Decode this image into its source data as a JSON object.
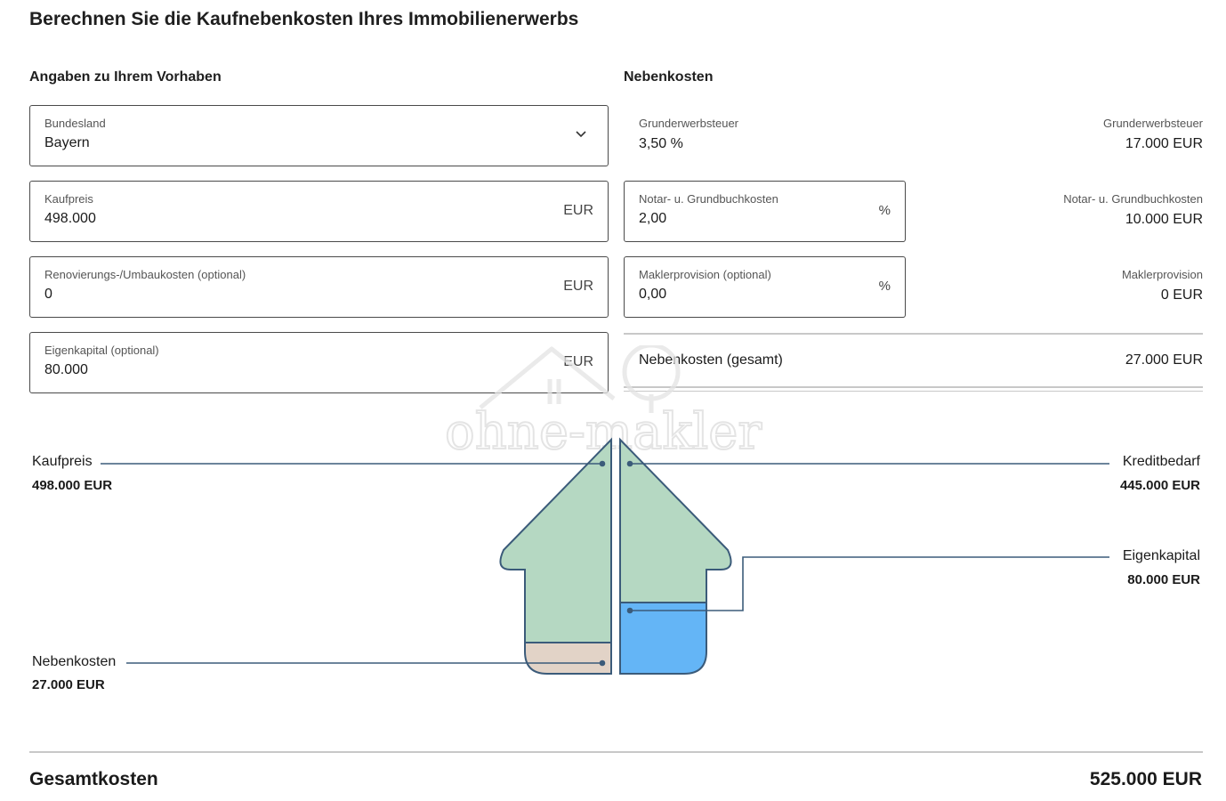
{
  "page": {
    "title": "Berechnen Sie die Kaufnebenkosten Ihres Immobilienerwerbs"
  },
  "left": {
    "section_title": "Angaben zu Ihrem Vorhaben",
    "bundesland": {
      "label": "Bundesland",
      "value": "Bayern"
    },
    "kaufpreis": {
      "label": "Kaufpreis",
      "value": "498.000",
      "unit": "EUR"
    },
    "renovierung": {
      "label": "Renovierungs-/Umbaukosten (optional)",
      "value": "0",
      "unit": "EUR"
    },
    "eigenkapital": {
      "label": "Eigenkapital (optional)",
      "value": "80.000",
      "unit": "EUR"
    }
  },
  "right": {
    "section_title": "Nebenkosten",
    "grunderwerbsteuer": {
      "label": "Grunderwerbsteuer",
      "value": "3,50 %",
      "result_label": "Grunderwerbsteuer",
      "result_value": "17.000 EUR"
    },
    "notar": {
      "label": "Notar- u. Grundbuchkosten",
      "value": "2,00",
      "unit": "%",
      "result_label": "Notar- u. Grundbuchkosten",
      "result_value": "10.000 EUR"
    },
    "makler": {
      "label": "Maklerprovision (optional)",
      "value": "0,00",
      "unit": "%",
      "result_label": "Maklerprovision",
      "result_value": "0 EUR"
    },
    "total": {
      "label": "Nebenkosten (gesamt)",
      "value": "27.000 EUR"
    }
  },
  "chart": {
    "kaufpreis": {
      "label": "Kaufpreis",
      "value": "498.000 EUR"
    },
    "kreditbedarf": {
      "label": "Kreditbedarf",
      "value": "445.000 EUR"
    },
    "eigenkapital": {
      "label": "Eigenkapital",
      "value": "80.000 EUR"
    },
    "nebenkosten": {
      "label": "Nebenkosten",
      "value": "27.000 EUR"
    },
    "colors": {
      "kaufpreis": "#b5d8c2",
      "kreditbedarf": "#b5d8c2",
      "eigenkapital": "#64b5f6",
      "nebenkosten": "#e2d3c7",
      "stroke": "#3b5b7a"
    }
  },
  "summary": {
    "label": "Gesamtkosten",
    "value": "525.000 EUR"
  },
  "watermark": {
    "text": "ohne-makler",
    "icon": "house-logo-icon"
  }
}
